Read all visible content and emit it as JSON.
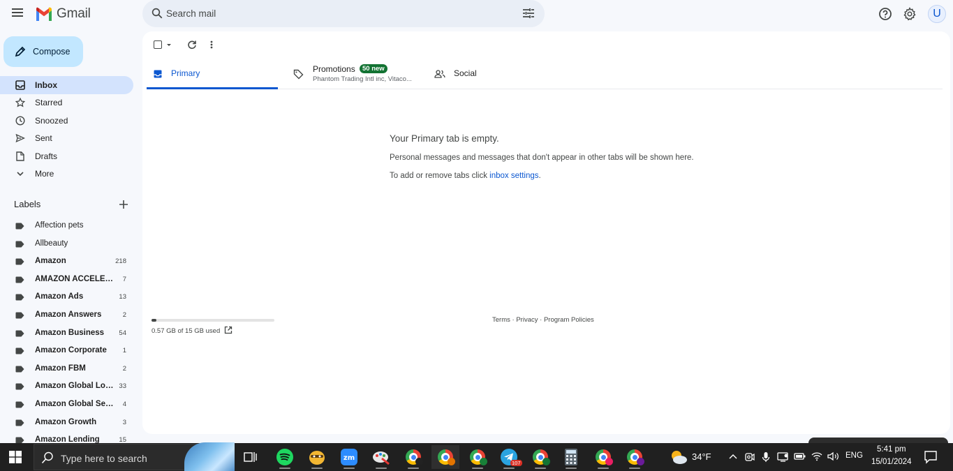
{
  "app": {
    "name": "Gmail"
  },
  "search": {
    "placeholder": "Search mail"
  },
  "compose": {
    "label": "Compose"
  },
  "nav": [
    {
      "label": "Inbox",
      "icon": "inbox-icon",
      "active": true
    },
    {
      "label": "Starred",
      "icon": "star-icon"
    },
    {
      "label": "Snoozed",
      "icon": "clock-icon"
    },
    {
      "label": "Sent",
      "icon": "send-icon"
    },
    {
      "label": "Drafts",
      "icon": "draft-icon"
    },
    {
      "label": "More",
      "icon": "chevron-down-icon"
    }
  ],
  "labels": {
    "title": "Labels",
    "items": [
      {
        "name": "Affection pets",
        "count": "",
        "bold": false
      },
      {
        "name": "Allbeauty",
        "count": "",
        "bold": false
      },
      {
        "name": "Amazon",
        "count": "218",
        "bold": true
      },
      {
        "name": "AMAZON ACCELERATOR",
        "count": "7",
        "bold": true
      },
      {
        "name": "Amazon Ads",
        "count": "13",
        "bold": true
      },
      {
        "name": "Amazon Answers",
        "count": "2",
        "bold": true
      },
      {
        "name": "Amazon Business",
        "count": "54",
        "bold": true
      },
      {
        "name": "Amazon Corporate",
        "count": "1",
        "bold": true
      },
      {
        "name": "Amazon FBM",
        "count": "2",
        "bold": true
      },
      {
        "name": "Amazon Global Logistics",
        "count": "33",
        "bold": true
      },
      {
        "name": "Amazon Global Selling",
        "count": "4",
        "bold": true
      },
      {
        "name": "Amazon Growth",
        "count": "3",
        "bold": true
      },
      {
        "name": "Amazon Lending",
        "count": "15",
        "bold": true
      }
    ]
  },
  "tabs": {
    "primary": "Primary",
    "promotions": "Promotions",
    "promotions_badge": "50 new",
    "promotions_sub": "Phantom Trading Intl inc, Vitaco...",
    "social": "Social"
  },
  "empty": {
    "title": "Your Primary tab is empty.",
    "desc": "Personal messages and messages that don't appear in other tabs will be shown here.",
    "link_prefix": "To add or remove tabs click ",
    "link_text": "inbox settings",
    "link_suffix": "."
  },
  "storage": {
    "text": "0.57 GB of 15 GB used",
    "used_fraction": 0.038
  },
  "footer": {
    "terms": "Terms",
    "privacy": "Privacy",
    "policies": "Program Policies",
    "sep": " · "
  },
  "user": {
    "avatar_letter": "U"
  },
  "taskbar": {
    "search_placeholder": "Type here to search",
    "weather_temp": "34°F",
    "language": "ENG",
    "time": "5:41 pm",
    "date": "15/01/2024",
    "telegram_badge": "107"
  }
}
